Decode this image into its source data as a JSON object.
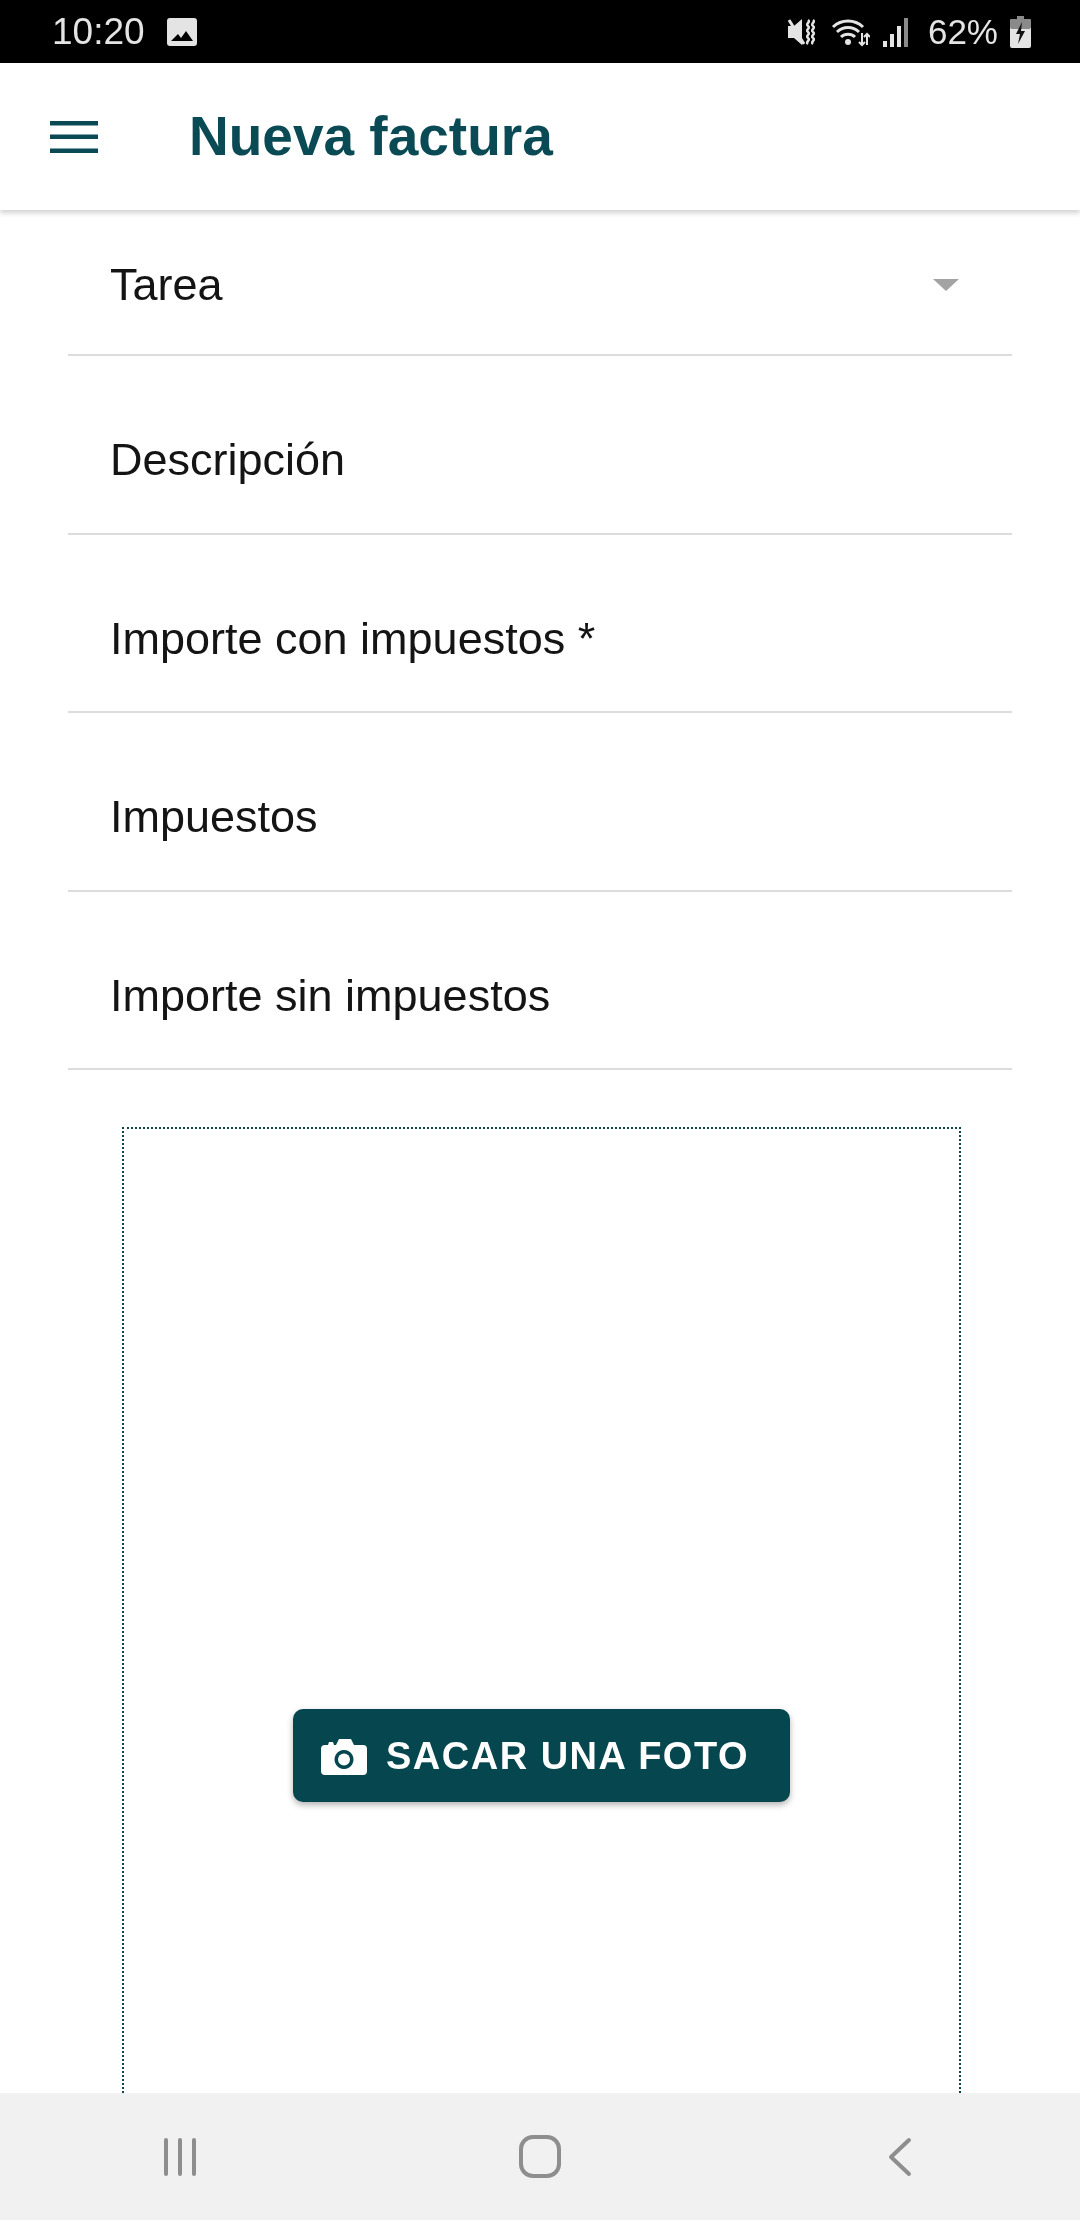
{
  "status_bar": {
    "time": "10:20",
    "battery": "62%"
  },
  "app_bar": {
    "title": "Nueva factura"
  },
  "fields": [
    {
      "kind": "select",
      "placeholder": "Tarea"
    },
    {
      "kind": "text",
      "placeholder": "Descripción"
    },
    {
      "kind": "text",
      "placeholder": "Importe con impuestos *"
    },
    {
      "kind": "text",
      "placeholder": "Impuestos"
    },
    {
      "kind": "text",
      "placeholder": "Importe sin impuestos"
    }
  ],
  "photo": {
    "button": "SACAR UNA FOTO"
  }
}
